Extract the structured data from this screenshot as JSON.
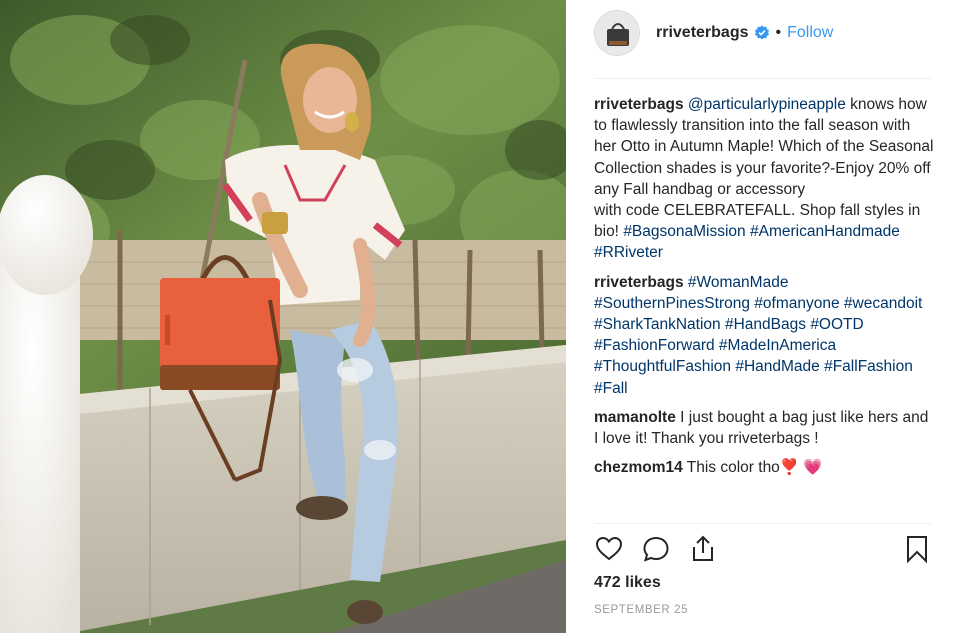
{
  "post": {
    "username": "rriveterbags",
    "follow_label": "Follow",
    "dot": "•",
    "likes": "472 likes",
    "date": "SEPTEMBER 25"
  },
  "comments": [
    {
      "user": "rriveterbags",
      "segments": [
        {
          "text": "@particularlypineapple",
          "tag": true
        },
        {
          "text": " knows how to flawlessly transition into the fall season with her Otto in Autumn Maple! Which of the Seasonal Collection shades is your favorite?-Enjoy 20% off any Fall handbag or accessory",
          "tag": false
        },
        {
          "br": true
        },
        {
          "text": "with code CELEBRATEFALL. Shop fall styles in bio! ",
          "tag": false
        },
        {
          "text": "#BagsonaMission",
          "tag": true
        },
        {
          "text": " ",
          "tag": false
        },
        {
          "text": "#AmericanHandmade",
          "tag": true
        },
        {
          "text": " ",
          "tag": false
        },
        {
          "text": "#RRiveter",
          "tag": true
        }
      ]
    },
    {
      "user": "rriveterbags",
      "segments": [
        {
          "text": "#WomanMade",
          "tag": true
        },
        {
          "text": " ",
          "tag": false
        },
        {
          "text": "#SouthernPinesStrong",
          "tag": true
        },
        {
          "text": " ",
          "tag": false
        },
        {
          "text": "#ofmanyone",
          "tag": true
        },
        {
          "text": " ",
          "tag": false
        },
        {
          "text": "#wecandoit",
          "tag": true
        },
        {
          "text": " ",
          "tag": false
        },
        {
          "text": "#SharkTankNation",
          "tag": true
        },
        {
          "text": " ",
          "tag": false
        },
        {
          "text": "#HandBags",
          "tag": true
        },
        {
          "text": " ",
          "tag": false
        },
        {
          "text": "#OOTD",
          "tag": true
        },
        {
          "text": " ",
          "tag": false
        },
        {
          "text": "#FashionForward",
          "tag": true
        },
        {
          "text": " ",
          "tag": false
        },
        {
          "text": "#MadeInAmerica",
          "tag": true
        },
        {
          "text": " ",
          "tag": false
        },
        {
          "text": "#ThoughtfulFashion",
          "tag": true
        },
        {
          "text": " ",
          "tag": false
        },
        {
          "text": "#HandMade",
          "tag": true
        },
        {
          "text": " ",
          "tag": false
        },
        {
          "text": "#FallFashion",
          "tag": true
        },
        {
          "text": " ",
          "tag": false
        },
        {
          "text": "#Fall",
          "tag": true
        }
      ]
    },
    {
      "user": "mamanolte",
      "segments": [
        {
          "text": "I just bought a bag just like hers and I love it! Thank you rriveterbags !",
          "tag": false
        }
      ]
    },
    {
      "user": "chezmom14",
      "segments": [
        {
          "text": "This color tho",
          "tag": false
        },
        {
          "text": "❣️ 💗",
          "tag": false,
          "emoji": true
        }
      ]
    }
  ],
  "icons": {
    "verified": "verified-badge-icon",
    "like": "heart-icon",
    "comment": "speech-bubble-icon",
    "share": "share-icon",
    "save": "bookmark-icon"
  },
  "colors": {
    "link": "#003569",
    "follow": "#3897f0",
    "verified": "#3897f0",
    "muted": "#999999",
    "bag": "#e8603c"
  }
}
